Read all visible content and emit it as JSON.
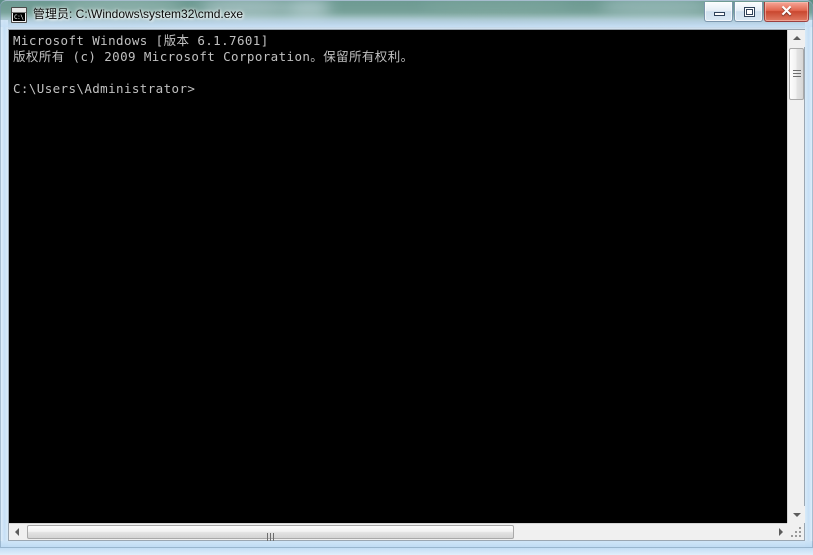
{
  "window": {
    "title": "管理员: C:\\Windows\\system32\\cmd.exe",
    "icon_name": "cmd-console-icon",
    "icon_glyph": "C:\\",
    "controls": {
      "minimize_label": "最小化",
      "maximize_label": "最大化",
      "close_label": "关闭",
      "close_glyph": "✕"
    },
    "colors": {
      "console_background": "#000000",
      "console_text": "#c0c0c0",
      "frame_glass": "#c6dff5",
      "close_button": "#c9472f",
      "desktop_backdrop": "#5d8f86"
    }
  },
  "console": {
    "lines": [
      "Microsoft Windows [版本 6.1.7601]",
      "版权所有 (c) 2009 Microsoft Corporation。保留所有权利。",
      "",
      "C:\\Users\\Administrator>"
    ],
    "text": "Microsoft Windows [版本 6.1.7601]\n版权所有 (c) 2009 Microsoft Corporation。保留所有权利。\n\nC:\\Users\\Administrator>",
    "prompt": "C:\\Users\\Administrator>",
    "os_name": "Microsoft Windows",
    "os_version": "6.1.7601",
    "copyright_year": "2009",
    "copyright_owner": "Microsoft Corporation"
  },
  "scrollbars": {
    "vertical": {
      "up_arrow_name": "scroll-up-arrow",
      "down_arrow_name": "scroll-down-arrow",
      "thumb_name": "vertical-scroll-thumb"
    },
    "horizontal": {
      "left_arrow_name": "scroll-left-arrow",
      "right_arrow_name": "scroll-right-arrow",
      "thumb_name": "horizontal-scroll-thumb"
    },
    "resize_grip_name": "window-resize-grip"
  }
}
